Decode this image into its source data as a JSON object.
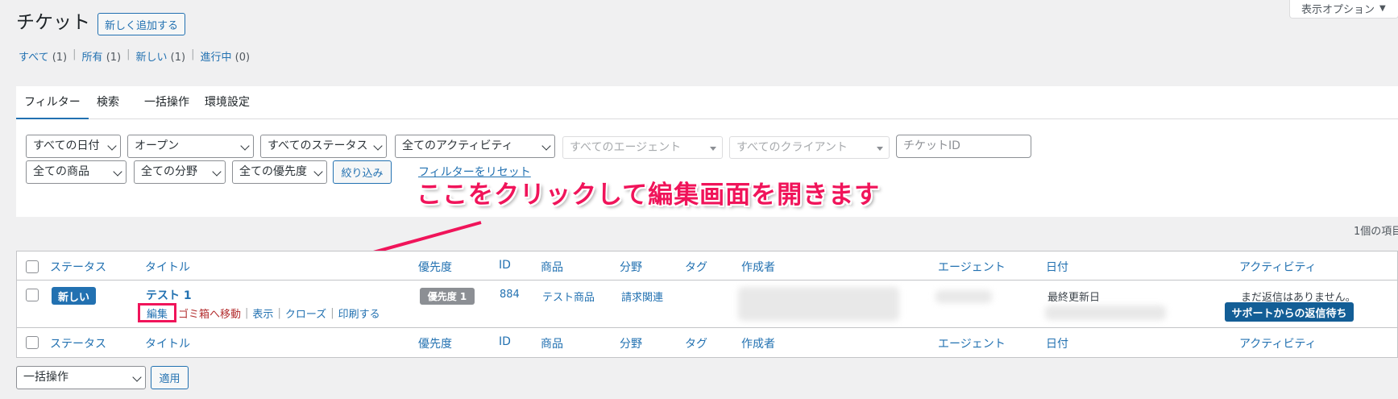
{
  "header": {
    "title": "チケット",
    "add_new": "新しく追加する",
    "screen_options": "表示オプション"
  },
  "views": [
    {
      "label": "すべて",
      "count": "(1)"
    },
    {
      "label": "所有",
      "count": "(1)"
    },
    {
      "label": "新しい",
      "count": "(1)"
    },
    {
      "label": "進行中",
      "count": "(0)"
    }
  ],
  "tabs": [
    "フィルター",
    "検索",
    "一括操作",
    "環境設定"
  ],
  "filters": {
    "date": "すべての日付",
    "state": "オープン",
    "status": "すべてのステータス",
    "activity": "全てのアクティビティ",
    "agent": "すべてのエージェント",
    "client": "すべてのクライアント",
    "ticket_id_placeholder": "チケットID",
    "product": "全ての商品",
    "category": "全ての分野",
    "priority": "全ての優先度",
    "apply": "絞り込み",
    "reset": "フィルターをリセット"
  },
  "annotation": "ここをクリックして編集画面を開きます",
  "items_count": "1個の項目",
  "table": {
    "columns": [
      "ステータス",
      "タイトル",
      "優先度",
      "ID",
      "商品",
      "分野",
      "タグ",
      "作成者",
      "エージェント",
      "日付",
      "アクティビティ"
    ],
    "rows": [
      {
        "status": "新しい",
        "title": "テスト 1",
        "priority": "優先度 1",
        "id": "884",
        "product": "テスト商品",
        "category": "請求関連",
        "date_label": "最終更新日",
        "activity": "まだ返信はありません。",
        "waiting": "サポートからの返信待ち",
        "actions": [
          "編集",
          "ゴミ箱へ移動",
          "表示",
          "クローズ",
          "印刷する"
        ]
      }
    ]
  },
  "bulk": {
    "select": "一括操作",
    "apply": "適用"
  },
  "colors": {
    "link": "#2271b1",
    "annotation": "#f0145a",
    "badge_new": "#2271b1",
    "badge_waiting": "#135e96"
  }
}
